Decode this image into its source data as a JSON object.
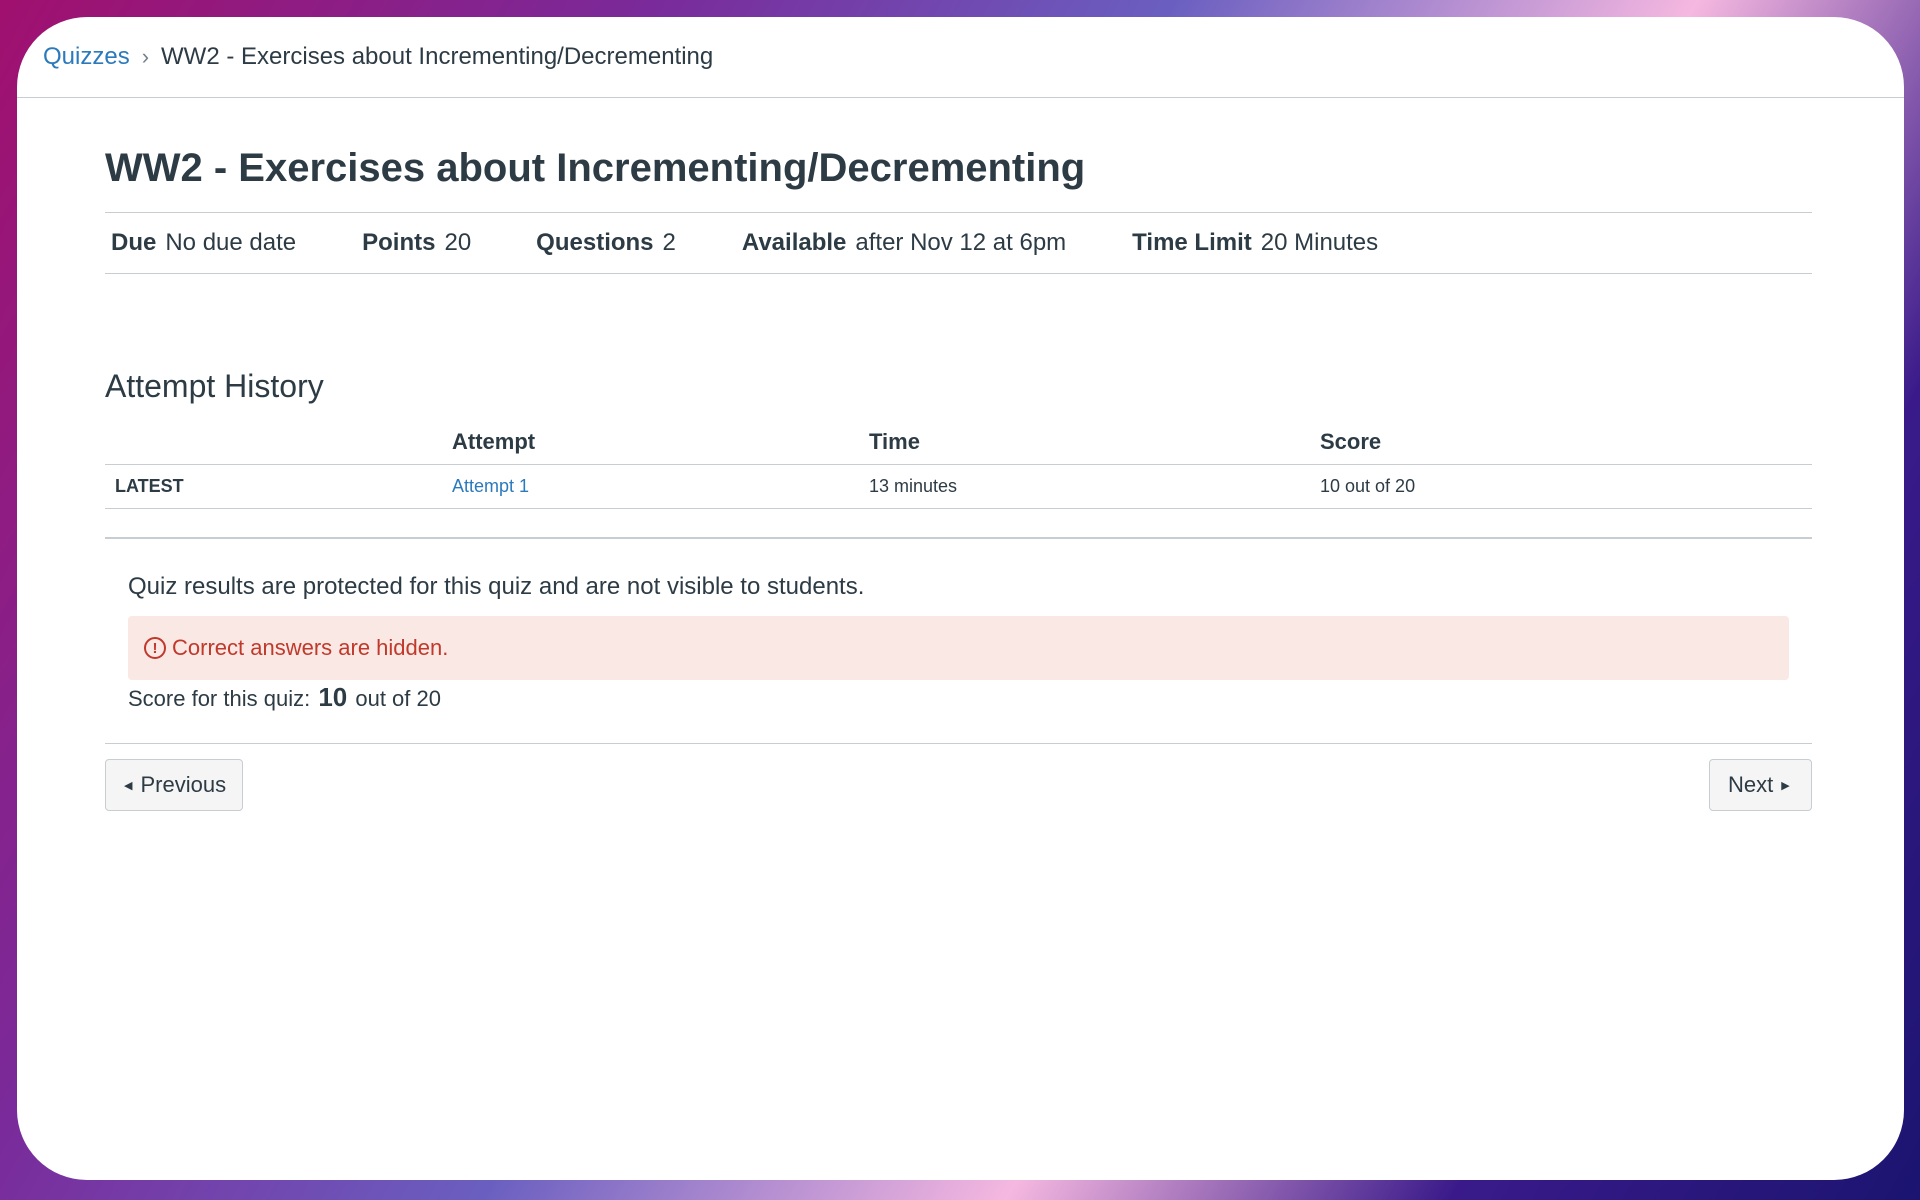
{
  "breadcrumb": {
    "root": "Quizzes",
    "separator": "›",
    "current": "WW2 - Exercises about Incrementing/Decrementing"
  },
  "quiz": {
    "title": "WW2 - Exercises about Incrementing/Decrementing",
    "meta": {
      "due_label": "Due",
      "due_value": "No due date",
      "points_label": "Points",
      "points_value": "20",
      "questions_label": "Questions",
      "questions_value": "2",
      "available_label": "Available",
      "available_value": "after Nov 12 at 6pm",
      "timelimit_label": "Time Limit",
      "timelimit_value": "20 Minutes"
    }
  },
  "attempt_history": {
    "title": "Attempt History",
    "columns": [
      "",
      "Attempt",
      "Time",
      "Score"
    ],
    "rows": [
      {
        "tag": "LATEST",
        "attempt": "Attempt 1",
        "time": "13 minutes",
        "score": "10 out of 20"
      }
    ]
  },
  "results": {
    "notice": "Quiz results are protected for this quiz and are not visible to students.",
    "alert_icon": "!",
    "alert_text": "Correct answers are hidden.",
    "score_prefix": "Score for this quiz:",
    "score_value": "10",
    "score_suffix": "out of 20"
  },
  "nav": {
    "previous_label": "Previous",
    "next_label": "Next",
    "previous_icon": "◀",
    "next_icon": "▶"
  },
  "colors": {
    "link": "#2b7abc",
    "alert_bg": "#f9e8e4",
    "alert_text": "#c0392b",
    "text": "#2d3b45"
  }
}
